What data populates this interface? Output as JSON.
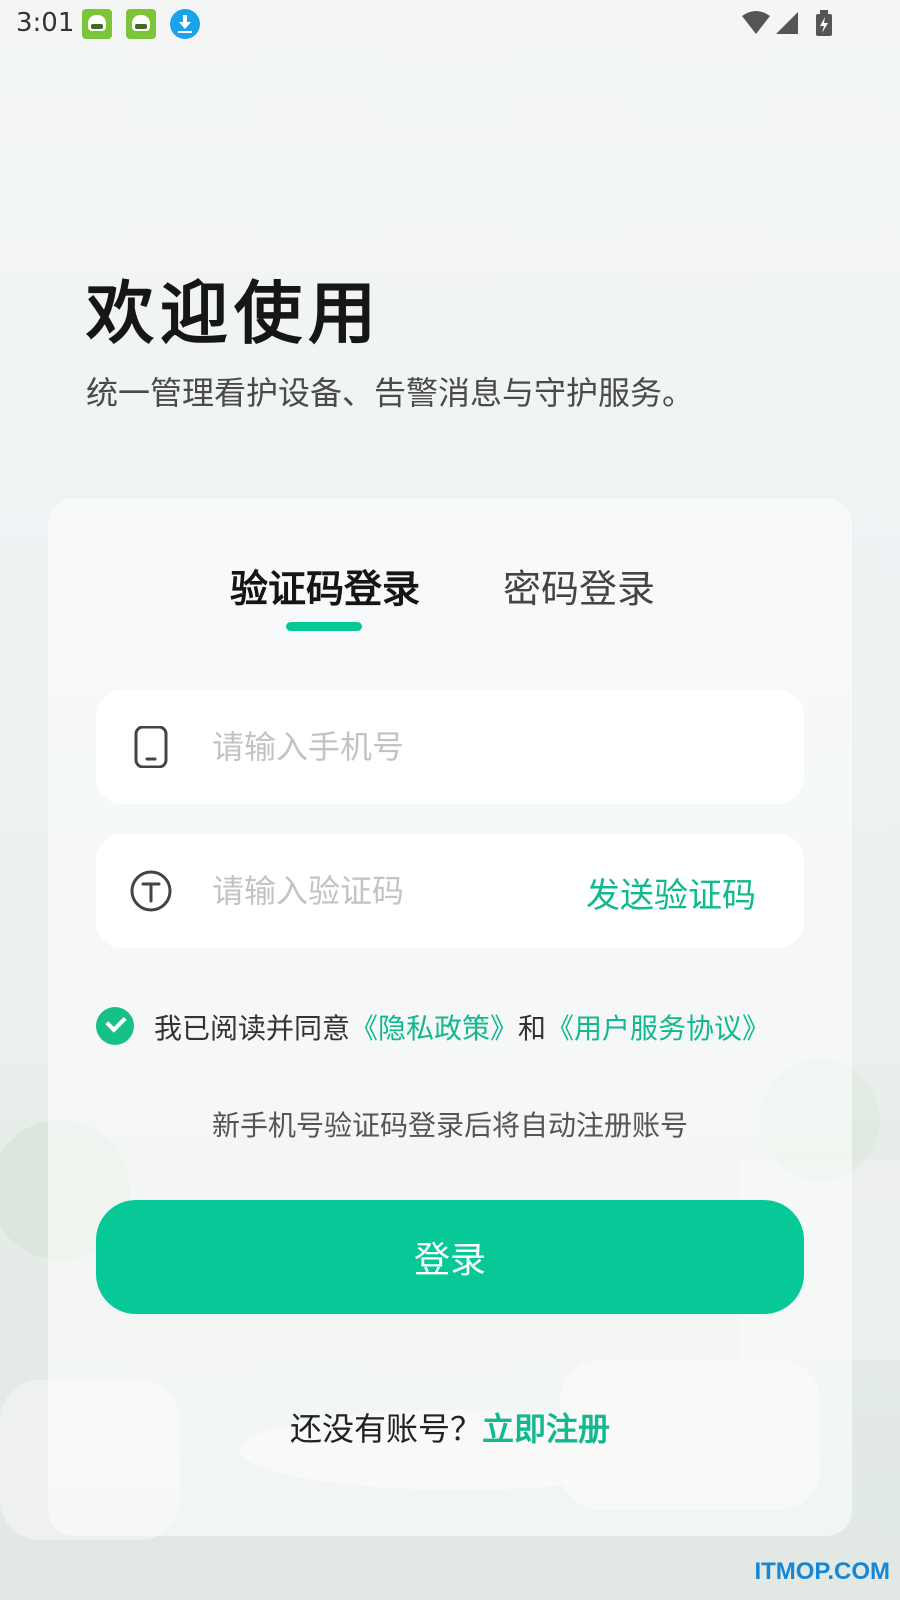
{
  "status_bar": {
    "time": "3:01",
    "icons": [
      "app-icon",
      "app-icon",
      "download-icon",
      "wifi-icon",
      "signal-icon",
      "battery-charging-icon"
    ]
  },
  "header": {
    "title": "欢迎使用",
    "subtitle": "统一管理看护设备、告警消息与守护服务。"
  },
  "tabs": [
    {
      "label": "验证码登录",
      "active": true
    },
    {
      "label": "密码登录",
      "active": false
    }
  ],
  "form": {
    "phone_placeholder": "请输入手机号",
    "phone_value": "",
    "code_placeholder": "请输入验证码",
    "code_value": "",
    "send_code_label": "发送验证码"
  },
  "agreement": {
    "checked": true,
    "prefix": "我已阅读并同意",
    "privacy_link": "《隐私政策》",
    "conjunction": "和",
    "terms_link": "《用户服务协议》"
  },
  "auto_register_tip": "新手机号验证码登录后将自动注册账号",
  "login_button_label": "登录",
  "register": {
    "question": "还没有账号？",
    "link": "立即注册"
  },
  "watermark": "ITMOP.COM",
  "colors": {
    "accent": "#06c997",
    "link": "#12b98f",
    "placeholder": "#c3c3c3"
  }
}
